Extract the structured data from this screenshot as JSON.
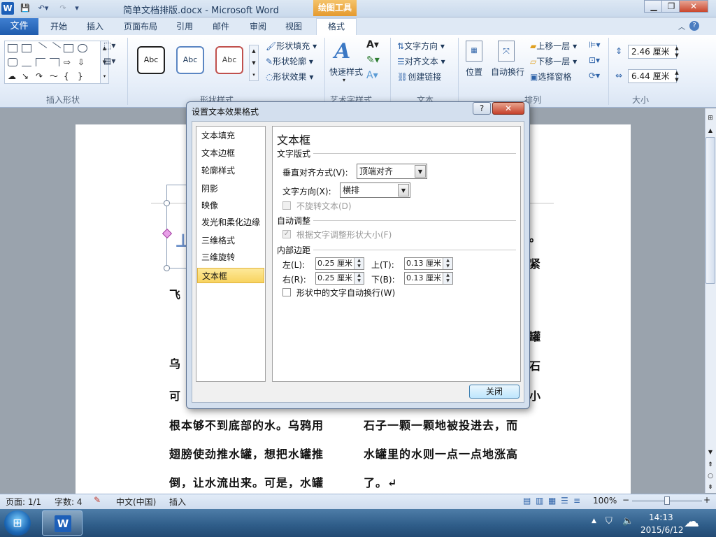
{
  "window": {
    "logo": "W",
    "title": "简单文档排版.docx - Microsoft Word",
    "drawing_tools": "绘图工具"
  },
  "ribbon_tabs": {
    "file": "文件",
    "home": "开始",
    "insert": "插入",
    "layout": "页面布局",
    "references": "引用",
    "mailings": "邮件",
    "review": "审阅",
    "view": "视图",
    "format": "格式"
  },
  "ribbon": {
    "groups": {
      "insert_shapes": "插入形状",
      "shape_styles": "形状样式",
      "art_styles": "艺术字样式",
      "text": "文本",
      "arrange": "排列",
      "size": "大小"
    },
    "style_samples": [
      "Abc",
      "Abc",
      "Abc"
    ],
    "shape_fill": "形状填充",
    "shape_outline": "形状轮廓",
    "shape_effects": "形状效果",
    "quick_styles": "快速样式",
    "text_direction": "文字方向",
    "align_text": "对齐文本",
    "create_link": "创建链接",
    "position": "位置",
    "wrap_text": "自动换行",
    "bring_forward": "上移一层",
    "send_backward": "下移一层",
    "selection_pane": "选择窗格",
    "height": "2.46 厘米",
    "width": "6.44 厘米"
  },
  "document": {
    "lines": [
      {
        "left": "飞",
        "right": ""
      },
      {
        "left": "乌",
        "right": ""
      },
      {
        "left": "可",
        "right": ""
      },
      {
        "left": "根本够不到底部的水。乌鸦用",
        "right": "石子一颗一颗地被投进去，而"
      },
      {
        "left": "翅膀使劲推水罐，想把水罐推",
        "right": "水罐里的水则一点一点地涨高"
      },
      {
        "left": "倒，让水流出来。可是，水罐",
        "right": "了。↵"
      }
    ],
    "right_edge_chars": [
      "。",
      "紧",
      "罐",
      "石",
      "小"
    ]
  },
  "dialog": {
    "title": "设置文本效果格式",
    "help": "?",
    "close_x": "✕",
    "nav_items": [
      "文本填充",
      "文本边框",
      "轮廓样式",
      "阴影",
      "映像",
      "发光和柔化边缘",
      "三维格式",
      "三维旋转",
      "文本框"
    ],
    "selected_nav": "文本框",
    "panel": {
      "heading": "文本框",
      "section_layout": "文字版式",
      "vertical_align_label": "垂直对齐方式(V):",
      "vertical_align_value": "顶端对齐",
      "text_direction_label": "文字方向(X):",
      "text_direction_value": "横排",
      "no_rotate": "不旋转文本(D)",
      "section_autofit": "自动调整",
      "resize_shape": "根据文字调整形状大小(F)",
      "section_margins": "内部边距",
      "left_label": "左(L):",
      "left_value": "0.25 厘米",
      "right_label": "右(R):",
      "right_value": "0.25 厘米",
      "top_label": "上(T):",
      "top_value": "0.13 厘米",
      "bottom_label": "下(B):",
      "bottom_value": "0.13 厘米",
      "wrap_label": "形状中的文字自动换行(W)"
    },
    "close_button": "关闭"
  },
  "status": {
    "page": "页面: 1/1",
    "words": "字数: 4",
    "language": "中文(中国)",
    "mode": "插入",
    "zoom": "100%",
    "zoom_minus": "−",
    "zoom_plus": "+"
  },
  "taskbar": {
    "time": "14:13",
    "date": "2015/6/12",
    "word_logo": "W"
  }
}
